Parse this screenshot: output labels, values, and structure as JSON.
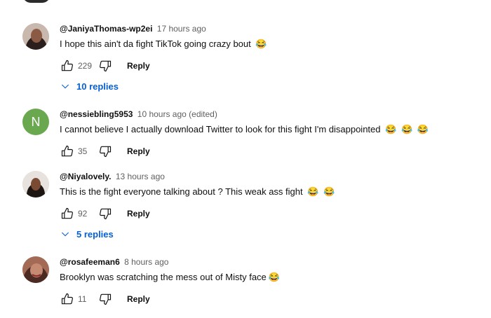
{
  "comments": [
    {
      "author": "@JaniyaThomas-wp2ei",
      "time": "17 hours ago",
      "text": "I hope this ain't da fight TikTok going crazy bout",
      "emojis": [
        "😂"
      ],
      "likes": "229",
      "reply_label": "Reply",
      "replies_label": "10 replies",
      "avatar_letter": ""
    },
    {
      "author": "@nessiebling5953",
      "time": "10 hours ago (edited)",
      "text": "I cannot believe I actually download Twitter to look for this fight  I'm disappointed",
      "emojis": [
        "😂",
        "😂",
        "😂"
      ],
      "likes": "35",
      "reply_label": "Reply",
      "replies_label": "",
      "avatar_letter": "N"
    },
    {
      "author": "@Niyalovely.",
      "time": "13 hours ago",
      "text": "This is the fight everyone talking about ? This weak ass fight",
      "emojis": [
        "😂",
        "😂"
      ],
      "likes": "92",
      "reply_label": "Reply",
      "replies_label": "5 replies",
      "avatar_letter": ""
    },
    {
      "author": "@rosafeeman6",
      "time": "8 hours ago",
      "text": "Brooklyn was scratching the mess out of Misty face",
      "emojis": [
        "😂"
      ],
      "likes": "11",
      "reply_label": "Reply",
      "replies_label": "",
      "avatar_letter": ""
    }
  ],
  "colors": {
    "link": "#065fd4",
    "letter_avatar": "#6aa84f"
  }
}
